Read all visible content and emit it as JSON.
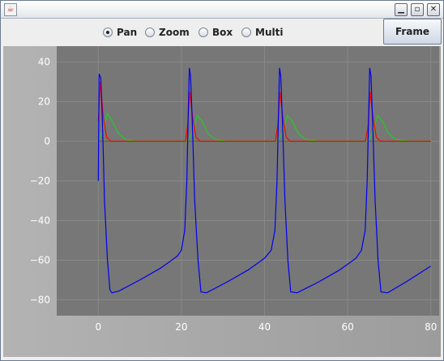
{
  "window": {
    "app_icon": "java-coffee-icon",
    "controls": [
      "minimize-icon",
      "maximize-icon",
      "close-icon"
    ]
  },
  "toolbar": {
    "modes": [
      {
        "label": "Pan",
        "selected": true
      },
      {
        "label": "Zoom",
        "selected": false
      },
      {
        "label": "Box",
        "selected": false
      },
      {
        "label": "Multi",
        "selected": false
      }
    ],
    "frame_label": "Frame"
  },
  "colors": {
    "plot_bg": "#777777",
    "blue": "#0000ee",
    "red": "#ff0000",
    "green": "#22cc22",
    "olive": "#6b6b10"
  },
  "chart_data": {
    "type": "line",
    "xlim": [
      -10,
      82
    ],
    "ylim": [
      -88,
      48
    ],
    "x_ticks": [
      "0",
      "20",
      "40",
      "60",
      "80"
    ],
    "y_ticks": [
      "40",
      "20",
      "0",
      "−20",
      "−40",
      "−60",
      "−80"
    ],
    "grid": true,
    "series": [
      {
        "color": "blue",
        "points": [
          [
            0,
            -20
          ],
          [
            0.2,
            34
          ],
          [
            0.6,
            32
          ],
          [
            1,
            10
          ],
          [
            1.5,
            -30
          ],
          [
            2.2,
            -60
          ],
          [
            2.8,
            -75
          ],
          [
            3.3,
            -76.5
          ],
          [
            5,
            -75.5
          ],
          [
            10,
            -70
          ],
          [
            15,
            -64
          ],
          [
            19,
            -58
          ],
          [
            20,
            -55
          ],
          [
            20.8,
            -45
          ],
          [
            21.3,
            -20
          ],
          [
            21.6,
            10
          ],
          [
            21.9,
            37
          ],
          [
            22.2,
            33
          ],
          [
            22.6,
            10
          ],
          [
            23.2,
            -30
          ],
          [
            24,
            -60
          ],
          [
            24.7,
            -76
          ],
          [
            26,
            -76.5
          ],
          [
            31,
            -71
          ],
          [
            36,
            -65
          ],
          [
            40,
            -59
          ],
          [
            41.6,
            -55
          ],
          [
            42.5,
            -45
          ],
          [
            43,
            -20
          ],
          [
            43.3,
            10
          ],
          [
            43.6,
            37
          ],
          [
            43.9,
            33
          ],
          [
            44.3,
            10
          ],
          [
            44.9,
            -30
          ],
          [
            45.6,
            -60
          ],
          [
            46.3,
            -76
          ],
          [
            47.8,
            -76.5
          ],
          [
            53,
            -71
          ],
          [
            58,
            -65
          ],
          [
            62,
            -59
          ],
          [
            63.3,
            -55
          ],
          [
            64.2,
            -45
          ],
          [
            64.7,
            -20
          ],
          [
            65,
            10
          ],
          [
            65.3,
            37
          ],
          [
            65.6,
            33
          ],
          [
            66,
            10
          ],
          [
            66.6,
            -30
          ],
          [
            67.3,
            -60
          ],
          [
            68,
            -76
          ],
          [
            69.6,
            -76.5
          ],
          [
            74,
            -71
          ],
          [
            80,
            -63
          ]
        ]
      },
      {
        "color": "red",
        "points": [
          [
            0,
            10
          ],
          [
            0.5,
            30
          ],
          [
            1.2,
            12
          ],
          [
            2,
            2
          ],
          [
            3,
            0
          ],
          [
            21,
            0
          ],
          [
            21.5,
            8
          ],
          [
            22,
            25
          ],
          [
            22.7,
            12
          ],
          [
            23.5,
            2
          ],
          [
            24.5,
            0
          ],
          [
            42.6,
            0
          ],
          [
            43.2,
            8
          ],
          [
            43.7,
            25
          ],
          [
            44.4,
            12
          ],
          [
            45.2,
            2
          ],
          [
            46.2,
            0
          ],
          [
            64.3,
            0
          ],
          [
            64.9,
            8
          ],
          [
            65.4,
            25
          ],
          [
            66.1,
            12
          ],
          [
            66.9,
            2
          ],
          [
            67.9,
            0
          ],
          [
            80,
            0
          ]
        ]
      },
      {
        "color": "green",
        "points": [
          [
            0,
            0
          ],
          [
            1,
            5
          ],
          [
            2.2,
            14
          ],
          [
            3.4,
            10
          ],
          [
            4.8,
            4
          ],
          [
            6.5,
            1
          ],
          [
            9,
            0
          ],
          [
            21.5,
            0
          ],
          [
            22.7,
            5
          ],
          [
            23.8,
            13
          ],
          [
            25,
            10
          ],
          [
            26.4,
            4
          ],
          [
            28,
            1
          ],
          [
            31,
            0
          ],
          [
            43.2,
            0
          ],
          [
            44.4,
            5
          ],
          [
            45.5,
            13
          ],
          [
            46.7,
            10
          ],
          [
            48.1,
            4
          ],
          [
            49.7,
            1
          ],
          [
            53,
            0
          ],
          [
            64.9,
            0
          ],
          [
            66.1,
            5
          ],
          [
            67.2,
            13
          ],
          [
            68.4,
            10
          ],
          [
            69.8,
            4
          ],
          [
            71.4,
            1
          ],
          [
            75,
            0
          ],
          [
            80,
            0
          ]
        ]
      },
      {
        "color": "olive",
        "points": [
          [
            0,
            0
          ],
          [
            80,
            0
          ]
        ]
      }
    ]
  }
}
